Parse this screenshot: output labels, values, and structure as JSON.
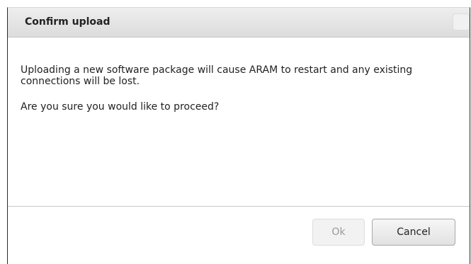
{
  "dialog": {
    "title": "Confirm upload",
    "message_line_1": "Uploading a new software package will cause ARAM to restart and any existing connections will be lost.",
    "message_line_2": "Are you sure you would like to proceed?",
    "buttons": {
      "ok_label": "Ok",
      "cancel_label": "Cancel"
    },
    "close_icon": "close-icon"
  }
}
